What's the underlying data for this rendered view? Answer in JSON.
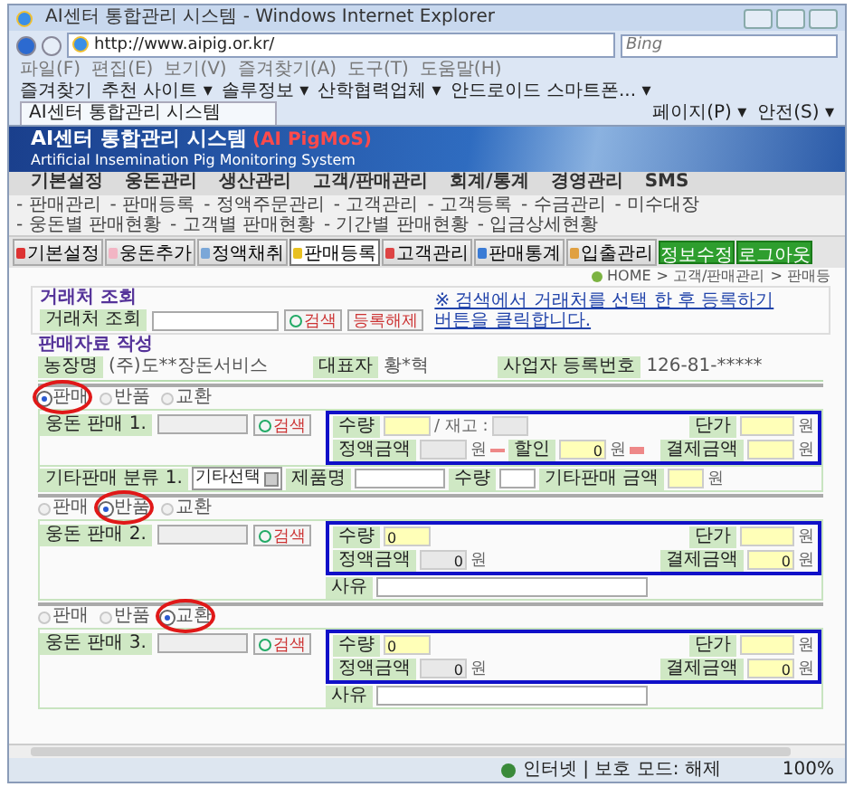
{
  "browser": {
    "title": "AI센터 통합관리 시스템 - Windows Internet Explorer",
    "url": "http://www.aipig.or.kr/",
    "search_placeholder": "Bing",
    "menu": [
      "파일(F)",
      "편집(E)",
      "보기(V)",
      "즐겨찾기(A)",
      "도구(T)",
      "도움말(H)"
    ],
    "favorites": [
      "즐겨찾기",
      "추천 사이트 ▾",
      "솔루정보 ▾",
      "산학협력업체 ▾",
      "안드로이드 스마트폰... ▾"
    ],
    "tab_title": "AI센터 통합관리 시스템",
    "commands": [
      "페이지(P) ▾",
      "안전(S) ▾"
    ]
  },
  "banner": {
    "title": "AI센터 통합관리 시스템",
    "title_suffix": "(AI PigMoS)",
    "subtitle": "Artificial Insemination Pig Monitoring System"
  },
  "main_nav": [
    "기본설정",
    "웅돈관리",
    "생산관리",
    "고객/판매관리",
    "회계/통계",
    "경영관리",
    "SMS"
  ],
  "sub_nav": [
    "- 판매관리",
    "- 판매등록",
    "- 정액주문관리",
    "- 고객관리",
    "- 고객등록",
    "- 수금관리",
    "- 미수대장",
    "- 웅돈별 판매현황",
    "- 고객별 판매현황",
    "- 기간별 판매현황",
    "- 입금상세현황"
  ],
  "toolbar": [
    {
      "label": "기본설정",
      "selected": false
    },
    {
      "label": "웅돈추가",
      "selected": false
    },
    {
      "label": "정액채취",
      "selected": false
    },
    {
      "label": "판매등록",
      "selected": true
    },
    {
      "label": "고객관리",
      "selected": false
    },
    {
      "label": "판매통계",
      "selected": false
    },
    {
      "label": "입출관리",
      "selected": false
    }
  ],
  "account_buttons": [
    "정보수정",
    "로그아웃"
  ],
  "breadcrumb": [
    "HOME",
    "> 고객/판매관리",
    "> 판매등"
  ],
  "customer_search": {
    "legend": "거래처 조회",
    "label": "거래처 조회",
    "search_button": "검색",
    "clear_button": "등록해제",
    "hint": "※ 검색에서 거래처를 선택 한 후 등록하기 버튼을 클릭합니다."
  },
  "sales_form": {
    "legend": "판매자료 작성",
    "farm_label": "농장명",
    "farm_value": "(주)도**장돈서비스",
    "rep_label": "대표자",
    "rep_value": "황*혁",
    "biz_label": "사업자 등록번호",
    "biz_value": "126-81-*****"
  },
  "entries": [
    {
      "kind": "sale",
      "options": [
        {
          "label": "판매",
          "selected": true
        },
        {
          "label": "반품",
          "selected": false
        },
        {
          "label": "교환",
          "selected": false
        }
      ],
      "product_label": "웅돈 판매 1.",
      "search_button": "검색",
      "quantity_label": "수량",
      "stock_label": "/ 재고 :",
      "price_label": "단가",
      "price_unit": "원",
      "amount_label": "정액금액",
      "amount_unit": "원",
      "discount_label": "할인",
      "discount": "0",
      "discount_unit": "원",
      "payment_label": "결제금액",
      "payment_unit": "원",
      "other_label": "기타판매 분류 1.",
      "other_select": "기타선택",
      "product_name_label": "제품명",
      "other_qty_label": "수량",
      "other_amount_label": "기타판매 금액",
      "other_unit": "원"
    },
    {
      "kind": "return",
      "options": [
        {
          "label": "판매",
          "selected": false
        },
        {
          "label": "반품",
          "selected": true
        },
        {
          "label": "교환",
          "selected": false
        }
      ],
      "product_label": "웅돈 판매 2.",
      "search_button": "검색",
      "quantity_label": "수량",
      "quantity": "0",
      "price_label": "단가",
      "price_unit": "원",
      "amount_label": "정액금액",
      "amount": "0",
      "amount_unit": "원",
      "payment_label": "결제금액",
      "payment": "0",
      "payment_unit": "원",
      "reason_label": "사유"
    },
    {
      "kind": "return",
      "options": [
        {
          "label": "판매",
          "selected": false
        },
        {
          "label": "반품",
          "selected": false
        },
        {
          "label": "교환",
          "selected": true
        }
      ],
      "product_label": "웅돈 판매 3.",
      "search_button": "검색",
      "quantity_label": "수량",
      "quantity": "0",
      "price_label": "단가",
      "price_unit": "원",
      "amount_label": "정액금액",
      "amount": "0",
      "amount_unit": "원",
      "payment_label": "결제금액",
      "payment": "0",
      "payment_unit": "원",
      "reason_label": "사유"
    }
  ],
  "status_bar": {
    "zone": "인터넷 | 보호 모드: 해제",
    "zoom": "100%"
  }
}
